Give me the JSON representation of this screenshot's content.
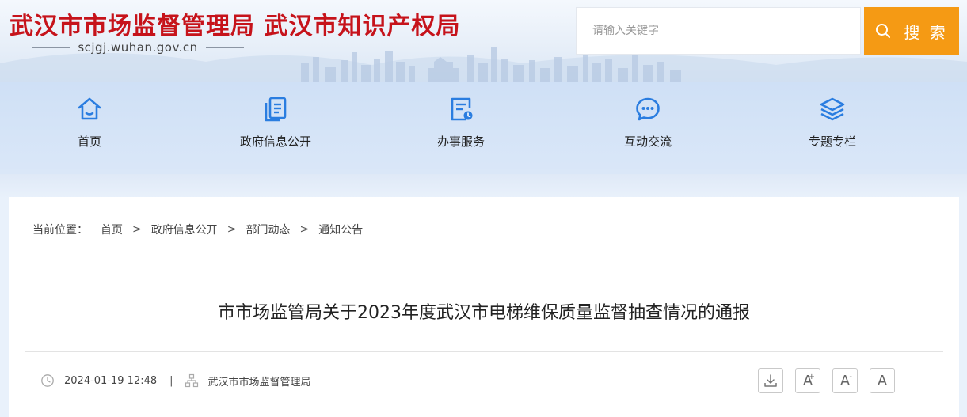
{
  "header": {
    "site_title": "武汉市市场监督管理局 武汉市知识产权局",
    "domain": "scjgj.wuhan.gov.cn"
  },
  "search": {
    "placeholder": "请输入关键字",
    "button_label": "搜 索"
  },
  "nav": {
    "items": [
      {
        "label": "首页",
        "icon": "home-icon"
      },
      {
        "label": "政府信息公开",
        "icon": "documents-icon"
      },
      {
        "label": "办事服务",
        "icon": "service-icon"
      },
      {
        "label": "互动交流",
        "icon": "chat-icon"
      },
      {
        "label": "专题专栏",
        "icon": "layers-icon"
      }
    ]
  },
  "breadcrumb": {
    "prefix": "当前位置：",
    "items": [
      "首页",
      "政府信息公开",
      "部门动态",
      "通知公告"
    ],
    "separator": ">"
  },
  "article": {
    "title": "市市场监管局关于2023年度武汉市电梯维保质量监督抽查情况的通报",
    "date": "2024-01-19 12:48",
    "meta_separator": "|",
    "source": "武汉市市场监督管理局"
  },
  "tools": {
    "font_increase": "A",
    "font_decrease": "A",
    "font_reset": "A",
    "plus": "+",
    "minus": "-"
  },
  "colors": {
    "brand_red": "#c6131b",
    "search_orange": "#f59a14",
    "nav_icon_blue": "#2a7de0"
  }
}
